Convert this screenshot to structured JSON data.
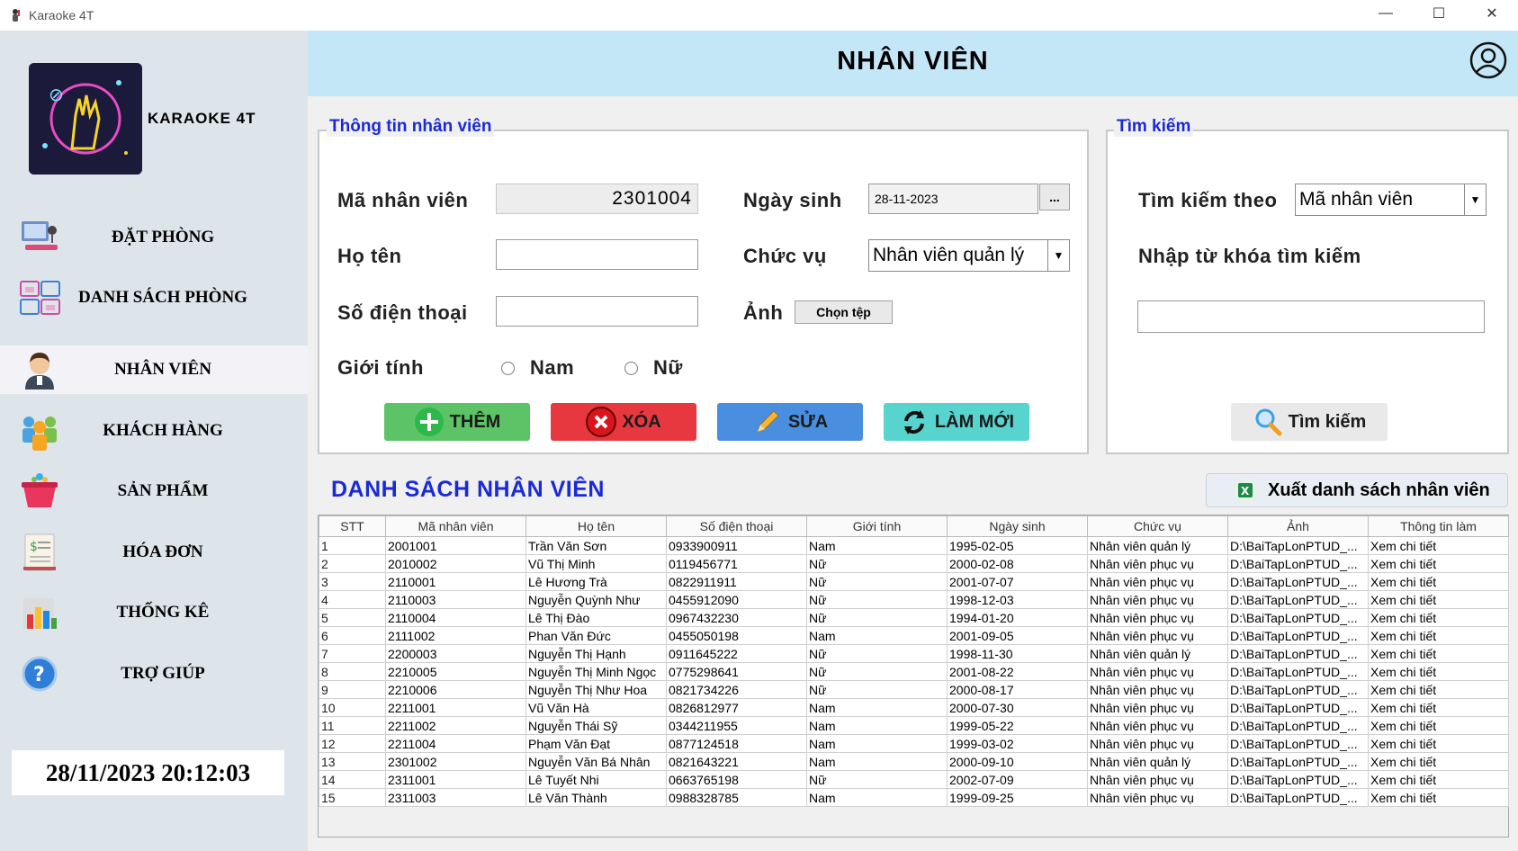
{
  "window": {
    "title": "Karaoke 4T",
    "minimize": "—",
    "maximize": "☐",
    "close": "✕"
  },
  "sidebar": {
    "brand": "KARAOKE 4T",
    "items": [
      {
        "label": "ĐẶT PHÒNG",
        "icon": "booking-icon"
      },
      {
        "label": "DANH SÁCH PHÒNG",
        "icon": "room-list-icon"
      },
      {
        "label": "NHÂN VIÊN",
        "icon": "employee-icon",
        "active": true
      },
      {
        "label": "KHÁCH HÀNG",
        "icon": "customers-icon"
      },
      {
        "label": "SẢN PHẨM",
        "icon": "products-icon"
      },
      {
        "label": "HÓA ĐƠN",
        "icon": "invoice-icon"
      },
      {
        "label": "THỐNG KÊ",
        "icon": "statistics-icon"
      },
      {
        "label": "TRỢ GIÚP",
        "icon": "help-icon"
      }
    ],
    "datetime": "28/11/2023 20:12:03"
  },
  "header": {
    "title": "NHÂN VIÊN"
  },
  "info_panel": {
    "legend": "Thông tin nhân viên",
    "employee_id_label": "Mã nhân viên",
    "employee_id_value": "2301004",
    "name_label": "Họ tên",
    "name_value": "",
    "phone_label": "Số điện thoại",
    "phone_value": "",
    "gender_label": "Giới tính",
    "gender_male": "Nam",
    "gender_female": "Nữ",
    "dob_label": "Ngày sinh",
    "dob_value": "28-11-2023",
    "dob_button": "...",
    "position_label": "Chức vụ",
    "position_value": "Nhân viên quản lý",
    "photo_label": "Ảnh",
    "photo_button": "Chọn tệp",
    "buttons": {
      "add": "THÊM",
      "delete": "XÓA",
      "edit": "SỬA",
      "refresh": "LÀM MỚI"
    }
  },
  "search_panel": {
    "legend": "Tìm kiếm",
    "search_by_label": "Tìm kiếm theo",
    "search_by_value": "Mã nhân viên",
    "keyword_label": "Nhập từ khóa tìm kiếm",
    "keyword_value": "",
    "search_button": "Tìm kiếm"
  },
  "list": {
    "title": "DANH SÁCH NHÂN VIÊN",
    "export_button": "Xuất danh sách nhân viên",
    "columns": [
      "STT",
      "Mã nhân viên",
      "Họ tên",
      "Số điện thoại",
      "Giới tính",
      "Ngày sinh",
      "Chức vụ",
      "Ảnh",
      "Thông tin làm"
    ],
    "rows": [
      [
        "1",
        "2001001",
        "Trần Văn Sơn",
        "0933900911",
        "Nam",
        "1995-02-05",
        "Nhân viên quản lý",
        "D:\\BaiTapLonPTUD_...",
        "Xem chi tiết"
      ],
      [
        "2",
        "2010002",
        "Vũ Thị Minh",
        "0119456771",
        "Nữ",
        "2000-02-08",
        "Nhân viên phục vụ",
        "D:\\BaiTapLonPTUD_...",
        "Xem chi tiết"
      ],
      [
        "3",
        "2110001",
        "Lê Hương Trà",
        "0822911911",
        "Nữ",
        "2001-07-07",
        "Nhân viên phục vụ",
        "D:\\BaiTapLonPTUD_...",
        "Xem chi tiết"
      ],
      [
        "4",
        "2110003",
        "Nguyễn Quỳnh Như",
        "0455912090",
        "Nữ",
        "1998-12-03",
        "Nhân viên phục vụ",
        "D:\\BaiTapLonPTUD_...",
        "Xem chi tiết"
      ],
      [
        "5",
        "2110004",
        "Lê Thị Đào",
        "0967432230",
        "Nữ",
        "1994-01-20",
        "Nhân viên phục vụ",
        "D:\\BaiTapLonPTUD_...",
        "Xem chi tiết"
      ],
      [
        "6",
        "2111002",
        "Phan Văn Đức",
        "0455050198",
        "Nam",
        "2001-09-05",
        "Nhân viên phục vụ",
        "D:\\BaiTapLonPTUD_...",
        "Xem chi tiết"
      ],
      [
        "7",
        "2200003",
        "Nguyễn Thị Hạnh",
        "0911645222",
        "Nữ",
        "1998-11-30",
        "Nhân viên quản lý",
        "D:\\BaiTapLonPTUD_...",
        "Xem chi tiết"
      ],
      [
        "8",
        "2210005",
        "Nguyễn Thị Minh Ngọc",
        "0775298641",
        "Nữ",
        "2001-08-22",
        "Nhân viên phục vụ",
        "D:\\BaiTapLonPTUD_...",
        "Xem chi tiết"
      ],
      [
        "9",
        "2210006",
        "Nguyễn Thị Như Hoa",
        "0821734226",
        "Nữ",
        "2000-08-17",
        "Nhân viên phục vụ",
        "D:\\BaiTapLonPTUD_...",
        "Xem chi tiết"
      ],
      [
        "10",
        "2211001",
        "Vũ Văn Hà",
        "0826812977",
        "Nam",
        "2000-07-30",
        "Nhân viên phục vụ",
        "D:\\BaiTapLonPTUD_...",
        "Xem chi tiết"
      ],
      [
        "11",
        "2211002",
        "Nguyễn Thái Sỹ",
        "0344211955",
        "Nam",
        "1999-05-22",
        "Nhân viên phục vụ",
        "D:\\BaiTapLonPTUD_...",
        "Xem chi tiết"
      ],
      [
        "12",
        "2211004",
        "Phạm Văn Đạt",
        "0877124518",
        "Nam",
        "1999-03-02",
        "Nhân viên phục vụ",
        "D:\\BaiTapLonPTUD_...",
        "Xem chi tiết"
      ],
      [
        "13",
        "2301002",
        "Nguyễn Văn Bá Nhân",
        "0821643221",
        "Nam",
        "2000-09-10",
        "Nhân viên quản lý",
        "D:\\BaiTapLonPTUD_...",
        "Xem chi tiết"
      ],
      [
        "14",
        "2311001",
        "Lê Tuyết Nhi",
        "0663765198",
        "Nữ",
        "2002-07-09",
        "Nhân viên phục vụ",
        "D:\\BaiTapLonPTUD_...",
        "Xem chi tiết"
      ],
      [
        "15",
        "2311003",
        "Lê Văn Thành",
        "0988328785",
        "Nam",
        "1999-09-25",
        "Nhân viên phục vụ",
        "D:\\BaiTapLonPTUD_...",
        "Xem chi tiết"
      ]
    ]
  },
  "colors": {
    "header_bg": "#c4e7f8",
    "sidebar_bg": "#dde5ea",
    "accent_blue": "#1a2ad6",
    "add_btn": "#5cc466",
    "delete_btn": "#e8383f",
    "edit_btn": "#4a8ee0",
    "refresh_btn": "#58d4cf"
  }
}
